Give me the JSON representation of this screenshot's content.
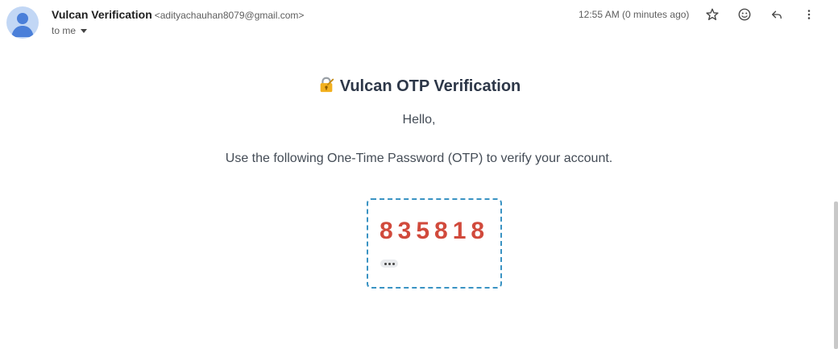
{
  "header": {
    "sender_name": "Vulcan Verification",
    "sender_email": "<adityachauhan8079@gmail.com>",
    "recipient": "to me",
    "timestamp": "12:55 AM (0 minutes ago)",
    "icons": [
      "star-icon",
      "emoji-icon",
      "reply-icon",
      "more-vert-icon"
    ]
  },
  "email_body": {
    "title": "Vulcan OTP Verification",
    "title_icon": "lock-icon",
    "greeting": "Hello,",
    "instruction": "Use the following One-Time Password (OTP) to verify your account.",
    "otp_code": "835818"
  },
  "colors": {
    "otp_code": "#d14a3c",
    "otp_border": "#3a93c3",
    "title": "#2d3748"
  }
}
